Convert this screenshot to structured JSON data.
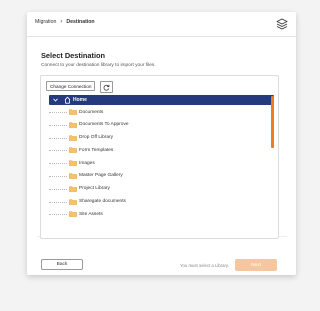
{
  "breadcrumb": {
    "items": [
      "Migration",
      "Destination"
    ],
    "separator": "›"
  },
  "header": {
    "layers_icon": "layers-icon"
  },
  "main": {
    "title": "Select Destination",
    "subtitle": "Connect to your destination library to import your files.",
    "change_connection_label": "Change Connection",
    "refresh_icon": "refresh-icon"
  },
  "tree": {
    "root": {
      "label": "Home",
      "icon": "home-icon",
      "expanded": true,
      "selected": true
    },
    "items": [
      {
        "label": "Documents",
        "icon": "folder-icon"
      },
      {
        "label": "Documents To Approve",
        "icon": "folder-icon"
      },
      {
        "label": "Drop Off Library",
        "icon": "folder-icon"
      },
      {
        "label": "Form Templates",
        "icon": "folder-icon"
      },
      {
        "label": "Images",
        "icon": "folder-icon"
      },
      {
        "label": "Master Page Gallery",
        "icon": "folder-icon"
      },
      {
        "label": "Project Library",
        "icon": "folder-icon"
      },
      {
        "label": "Sharegate documents",
        "icon": "folder-icon"
      },
      {
        "label": "Site Assets",
        "icon": "folder-icon"
      }
    ]
  },
  "footer": {
    "back_label": "Back",
    "message": "You must select a Library.",
    "next_label": "Next"
  },
  "colors": {
    "selection": "#243a7d",
    "accent": "#f07d1a",
    "next_disabled": "#f6c79e",
    "folder": "#f5c26b"
  }
}
